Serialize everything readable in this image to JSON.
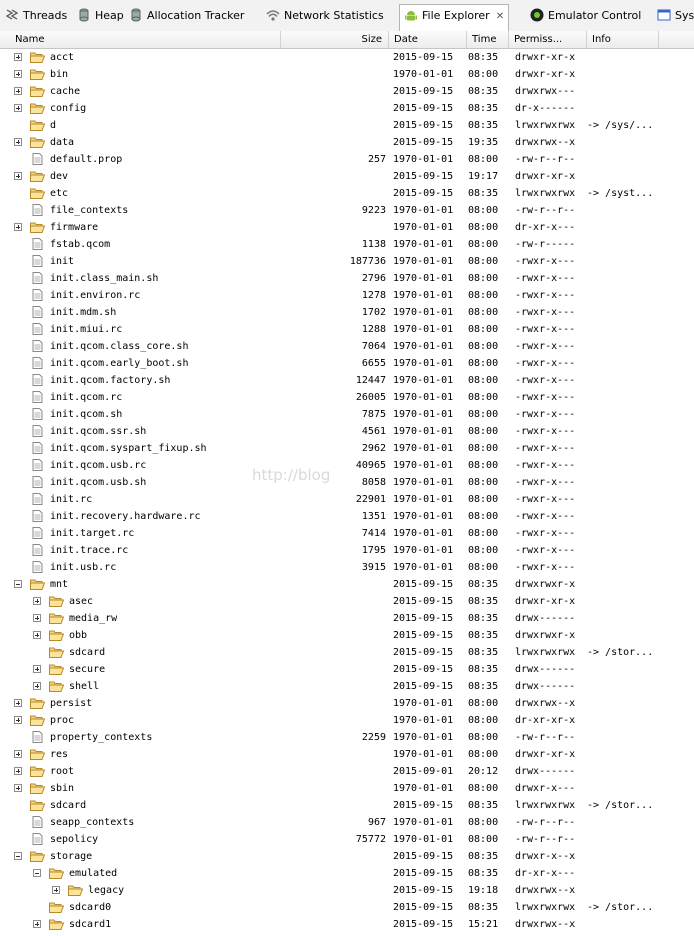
{
  "tabs": [
    {
      "label": "Threads",
      "icon": "threads-icon"
    },
    {
      "label": "Heap",
      "icon": "heap-icon"
    },
    {
      "label": "Allocation Tracker",
      "icon": "allocation-tracker-icon"
    },
    {
      "label": "Network Statistics",
      "icon": "network-statistics-icon"
    },
    {
      "label": "File Explorer",
      "icon": "android-icon",
      "active": true
    },
    {
      "label": "Emulator Control",
      "icon": "emulator-control-icon"
    },
    {
      "label": "Sys",
      "icon": "system-info-icon"
    }
  ],
  "columns": {
    "name": "Name",
    "size": "Size",
    "date": "Date",
    "time": "Time",
    "permissions": "Permiss...",
    "info": "Info"
  },
  "watermark": "http://blog",
  "files": [
    {
      "name": "acct",
      "depth": 0,
      "type": "dir",
      "expander": "plus",
      "size": "",
      "date": "2015-09-15",
      "time": "08:35",
      "perm": "drwxr-xr-x",
      "info": ""
    },
    {
      "name": "bin",
      "depth": 0,
      "type": "dir",
      "expander": "plus",
      "size": "",
      "date": "1970-01-01",
      "time": "08:00",
      "perm": "drwxr-xr-x",
      "info": ""
    },
    {
      "name": "cache",
      "depth": 0,
      "type": "dir",
      "expander": "plus",
      "size": "",
      "date": "2015-09-15",
      "time": "08:35",
      "perm": "drwxrwx---",
      "info": ""
    },
    {
      "name": "config",
      "depth": 0,
      "type": "dir",
      "expander": "plus",
      "size": "",
      "date": "2015-09-15",
      "time": "08:35",
      "perm": "dr-x------",
      "info": ""
    },
    {
      "name": "d",
      "depth": 0,
      "type": "dir",
      "expander": "none",
      "size": "",
      "date": "2015-09-15",
      "time": "08:35",
      "perm": "lrwxrwxrwx",
      "info": "-> /sys/..."
    },
    {
      "name": "data",
      "depth": 0,
      "type": "dir",
      "expander": "plus",
      "size": "",
      "date": "2015-09-15",
      "time": "19:35",
      "perm": "drwxrwx--x",
      "info": ""
    },
    {
      "name": "default.prop",
      "depth": 0,
      "type": "file",
      "expander": "none",
      "size": "257",
      "date": "1970-01-01",
      "time": "08:00",
      "perm": "-rw-r--r--",
      "info": ""
    },
    {
      "name": "dev",
      "depth": 0,
      "type": "dir",
      "expander": "plus",
      "size": "",
      "date": "2015-09-15",
      "time": "19:17",
      "perm": "drwxr-xr-x",
      "info": ""
    },
    {
      "name": "etc",
      "depth": 0,
      "type": "dir",
      "expander": "none",
      "size": "",
      "date": "2015-09-15",
      "time": "08:35",
      "perm": "lrwxrwxrwx",
      "info": "-> /syst..."
    },
    {
      "name": "file_contexts",
      "depth": 0,
      "type": "file",
      "expander": "none",
      "size": "9223",
      "date": "1970-01-01",
      "time": "08:00",
      "perm": "-rw-r--r--",
      "info": ""
    },
    {
      "name": "firmware",
      "depth": 0,
      "type": "dir",
      "expander": "plus",
      "size": "",
      "date": "1970-01-01",
      "time": "08:00",
      "perm": "dr-xr-x---",
      "info": ""
    },
    {
      "name": "fstab.qcom",
      "depth": 0,
      "type": "file",
      "expander": "none",
      "size": "1138",
      "date": "1970-01-01",
      "time": "08:00",
      "perm": "-rw-r-----",
      "info": ""
    },
    {
      "name": "init",
      "depth": 0,
      "type": "file",
      "expander": "none",
      "size": "187736",
      "date": "1970-01-01",
      "time": "08:00",
      "perm": "-rwxr-x---",
      "info": ""
    },
    {
      "name": "init.class_main.sh",
      "depth": 0,
      "type": "file",
      "expander": "none",
      "size": "2796",
      "date": "1970-01-01",
      "time": "08:00",
      "perm": "-rwxr-x---",
      "info": ""
    },
    {
      "name": "init.environ.rc",
      "depth": 0,
      "type": "file",
      "expander": "none",
      "size": "1278",
      "date": "1970-01-01",
      "time": "08:00",
      "perm": "-rwxr-x---",
      "info": ""
    },
    {
      "name": "init.mdm.sh",
      "depth": 0,
      "type": "file",
      "expander": "none",
      "size": "1702",
      "date": "1970-01-01",
      "time": "08:00",
      "perm": "-rwxr-x---",
      "info": ""
    },
    {
      "name": "init.miui.rc",
      "depth": 0,
      "type": "file",
      "expander": "none",
      "size": "1288",
      "date": "1970-01-01",
      "time": "08:00",
      "perm": "-rwxr-x---",
      "info": ""
    },
    {
      "name": "init.qcom.class_core.sh",
      "depth": 0,
      "type": "file",
      "expander": "none",
      "size": "7064",
      "date": "1970-01-01",
      "time": "08:00",
      "perm": "-rwxr-x---",
      "info": ""
    },
    {
      "name": "init.qcom.early_boot.sh",
      "depth": 0,
      "type": "file",
      "expander": "none",
      "size": "6655",
      "date": "1970-01-01",
      "time": "08:00",
      "perm": "-rwxr-x---",
      "info": ""
    },
    {
      "name": "init.qcom.factory.sh",
      "depth": 0,
      "type": "file",
      "expander": "none",
      "size": "12447",
      "date": "1970-01-01",
      "time": "08:00",
      "perm": "-rwxr-x---",
      "info": ""
    },
    {
      "name": "init.qcom.rc",
      "depth": 0,
      "type": "file",
      "expander": "none",
      "size": "26005",
      "date": "1970-01-01",
      "time": "08:00",
      "perm": "-rwxr-x---",
      "info": ""
    },
    {
      "name": "init.qcom.sh",
      "depth": 0,
      "type": "file",
      "expander": "none",
      "size": "7875",
      "date": "1970-01-01",
      "time": "08:00",
      "perm": "-rwxr-x---",
      "info": ""
    },
    {
      "name": "init.qcom.ssr.sh",
      "depth": 0,
      "type": "file",
      "expander": "none",
      "size": "4561",
      "date": "1970-01-01",
      "time": "08:00",
      "perm": "-rwxr-x---",
      "info": ""
    },
    {
      "name": "init.qcom.syspart_fixup.sh",
      "depth": 0,
      "type": "file",
      "expander": "none",
      "size": "2962",
      "date": "1970-01-01",
      "time": "08:00",
      "perm": "-rwxr-x---",
      "info": ""
    },
    {
      "name": "init.qcom.usb.rc",
      "depth": 0,
      "type": "file",
      "expander": "none",
      "size": "40965",
      "date": "1970-01-01",
      "time": "08:00",
      "perm": "-rwxr-x---",
      "info": ""
    },
    {
      "name": "init.qcom.usb.sh",
      "depth": 0,
      "type": "file",
      "expander": "none",
      "size": "8058",
      "date": "1970-01-01",
      "time": "08:00",
      "perm": "-rwxr-x---",
      "info": ""
    },
    {
      "name": "init.rc",
      "depth": 0,
      "type": "file",
      "expander": "none",
      "size": "22901",
      "date": "1970-01-01",
      "time": "08:00",
      "perm": "-rwxr-x---",
      "info": ""
    },
    {
      "name": "init.recovery.hardware.rc",
      "depth": 0,
      "type": "file",
      "expander": "none",
      "size": "1351",
      "date": "1970-01-01",
      "time": "08:00",
      "perm": "-rwxr-x---",
      "info": ""
    },
    {
      "name": "init.target.rc",
      "depth": 0,
      "type": "file",
      "expander": "none",
      "size": "7414",
      "date": "1970-01-01",
      "time": "08:00",
      "perm": "-rwxr-x---",
      "info": ""
    },
    {
      "name": "init.trace.rc",
      "depth": 0,
      "type": "file",
      "expander": "none",
      "size": "1795",
      "date": "1970-01-01",
      "time": "08:00",
      "perm": "-rwxr-x---",
      "info": ""
    },
    {
      "name": "init.usb.rc",
      "depth": 0,
      "type": "file",
      "expander": "none",
      "size": "3915",
      "date": "1970-01-01",
      "time": "08:00",
      "perm": "-rwxr-x---",
      "info": ""
    },
    {
      "name": "mnt",
      "depth": 0,
      "type": "dir",
      "expander": "minus",
      "size": "",
      "date": "2015-09-15",
      "time": "08:35",
      "perm": "drwxrwxr-x",
      "info": ""
    },
    {
      "name": "asec",
      "depth": 1,
      "type": "dir",
      "expander": "plus",
      "size": "",
      "date": "2015-09-15",
      "time": "08:35",
      "perm": "drwxr-xr-x",
      "info": ""
    },
    {
      "name": "media_rw",
      "depth": 1,
      "type": "dir",
      "expander": "plus",
      "size": "",
      "date": "2015-09-15",
      "time": "08:35",
      "perm": "drwx------",
      "info": ""
    },
    {
      "name": "obb",
      "depth": 1,
      "type": "dir",
      "expander": "plus",
      "size": "",
      "date": "2015-09-15",
      "time": "08:35",
      "perm": "drwxrwxr-x",
      "info": ""
    },
    {
      "name": "sdcard",
      "depth": 1,
      "type": "dir",
      "expander": "none",
      "size": "",
      "date": "2015-09-15",
      "time": "08:35",
      "perm": "lrwxrwxrwx",
      "info": "-> /stor..."
    },
    {
      "name": "secure",
      "depth": 1,
      "type": "dir",
      "expander": "plus",
      "size": "",
      "date": "2015-09-15",
      "time": "08:35",
      "perm": "drwx------",
      "info": ""
    },
    {
      "name": "shell",
      "depth": 1,
      "type": "dir",
      "expander": "plus",
      "size": "",
      "date": "2015-09-15",
      "time": "08:35",
      "perm": "drwx------",
      "info": ""
    },
    {
      "name": "persist",
      "depth": 0,
      "type": "dir",
      "expander": "plus",
      "size": "",
      "date": "1970-01-01",
      "time": "08:00",
      "perm": "drwxrwx--x",
      "info": ""
    },
    {
      "name": "proc",
      "depth": 0,
      "type": "dir",
      "expander": "plus",
      "size": "",
      "date": "1970-01-01",
      "time": "08:00",
      "perm": "dr-xr-xr-x",
      "info": ""
    },
    {
      "name": "property_contexts",
      "depth": 0,
      "type": "file",
      "expander": "none",
      "size": "2259",
      "date": "1970-01-01",
      "time": "08:00",
      "perm": "-rw-r--r--",
      "info": ""
    },
    {
      "name": "res",
      "depth": 0,
      "type": "dir",
      "expander": "plus",
      "size": "",
      "date": "1970-01-01",
      "time": "08:00",
      "perm": "drwxr-xr-x",
      "info": ""
    },
    {
      "name": "root",
      "depth": 0,
      "type": "dir",
      "expander": "plus",
      "size": "",
      "date": "2015-09-01",
      "time": "20:12",
      "perm": "drwx------",
      "info": ""
    },
    {
      "name": "sbin",
      "depth": 0,
      "type": "dir",
      "expander": "plus",
      "size": "",
      "date": "1970-01-01",
      "time": "08:00",
      "perm": "drwxr-x---",
      "info": ""
    },
    {
      "name": "sdcard",
      "depth": 0,
      "type": "dir",
      "expander": "none",
      "size": "",
      "date": "2015-09-15",
      "time": "08:35",
      "perm": "lrwxrwxrwx",
      "info": "-> /stor..."
    },
    {
      "name": "seapp_contexts",
      "depth": 0,
      "type": "file",
      "expander": "none",
      "size": "967",
      "date": "1970-01-01",
      "time": "08:00",
      "perm": "-rw-r--r--",
      "info": ""
    },
    {
      "name": "sepolicy",
      "depth": 0,
      "type": "file",
      "expander": "none",
      "size": "75772",
      "date": "1970-01-01",
      "time": "08:00",
      "perm": "-rw-r--r--",
      "info": ""
    },
    {
      "name": "storage",
      "depth": 0,
      "type": "dir",
      "expander": "minus",
      "size": "",
      "date": "2015-09-15",
      "time": "08:35",
      "perm": "drwxr-x--x",
      "info": ""
    },
    {
      "name": "emulated",
      "depth": 1,
      "type": "dir",
      "expander": "minus",
      "size": "",
      "date": "2015-09-15",
      "time": "08:35",
      "perm": "dr-xr-x---",
      "info": ""
    },
    {
      "name": "legacy",
      "depth": 2,
      "type": "dir",
      "expander": "plus",
      "size": "",
      "date": "2015-09-15",
      "time": "19:18",
      "perm": "drwxrwx--x",
      "info": ""
    },
    {
      "name": "sdcard0",
      "depth": 1,
      "type": "dir",
      "expander": "none",
      "size": "",
      "date": "2015-09-15",
      "time": "08:35",
      "perm": "lrwxrwxrwx",
      "info": "-> /stor..."
    },
    {
      "name": "sdcard1",
      "depth": 1,
      "type": "dir",
      "expander": "plus",
      "size": "",
      "date": "2015-09-15",
      "time": "15:21",
      "perm": "drwxrwx--x",
      "info": ""
    }
  ]
}
